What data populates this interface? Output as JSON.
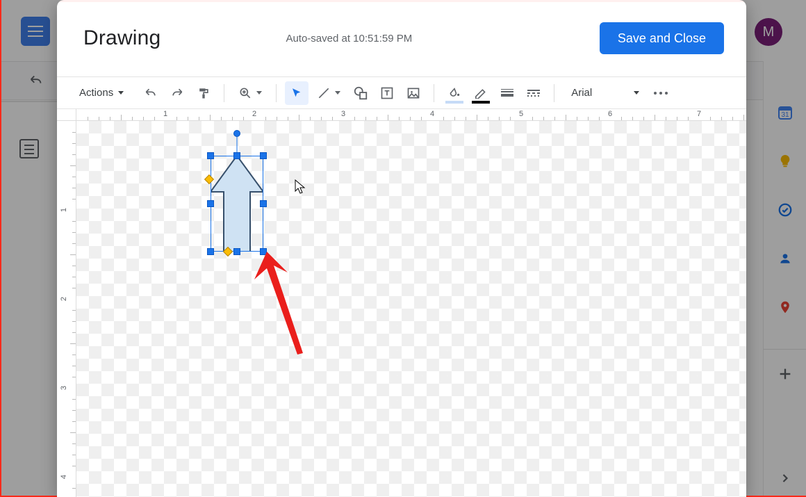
{
  "app": {
    "avatar_initial": "M"
  },
  "modal": {
    "title": "Drawing",
    "status": "Auto-saved at 10:51:59 PM",
    "save_label": "Save and Close"
  },
  "toolbar": {
    "actions_label": "Actions",
    "font_name": "Arial"
  },
  "ruler": {
    "h_labels": [
      "1",
      "2",
      "3",
      "4",
      "5",
      "6",
      "7"
    ],
    "v_labels": [
      "1",
      "2",
      "3",
      "4"
    ]
  },
  "colors": {
    "accent": "#1a73e8",
    "fill_underline": "#c6dbf7",
    "border_underline": "#000000",
    "annotation": "#ea1f1c"
  }
}
